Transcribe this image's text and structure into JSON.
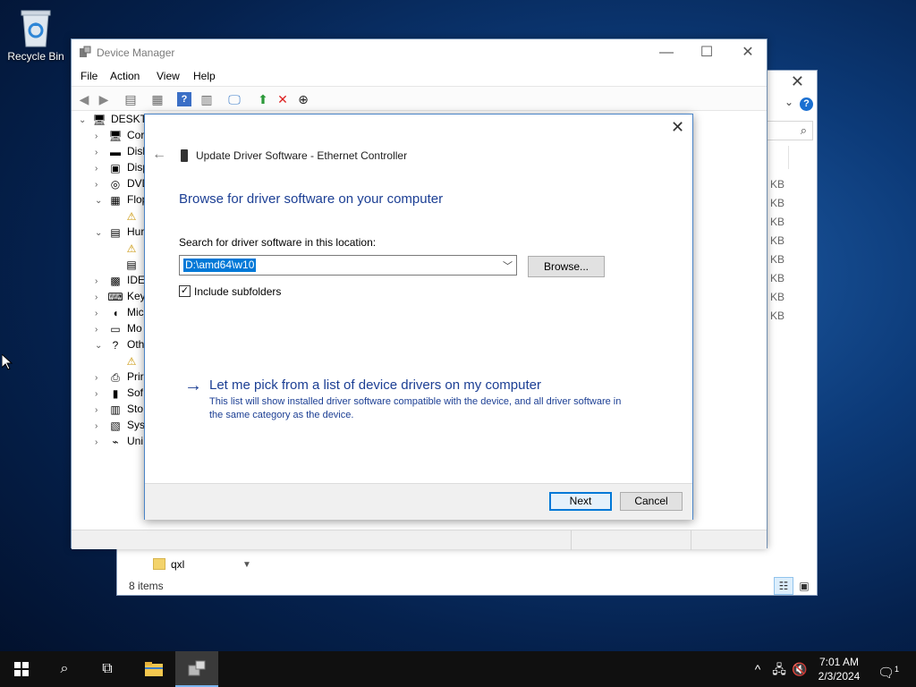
{
  "desktop": {
    "recycle_bin_label": "Recycle Bin"
  },
  "explorer": {
    "close_glyph": "✕",
    "size_unit": "KB",
    "visible_item": "qxl",
    "status": "8 items"
  },
  "device_manager": {
    "title": "Device Manager",
    "menu": [
      "File",
      "Action",
      "View",
      "Help"
    ],
    "tree": [
      {
        "label": "DESKTO",
        "icon": "computer-icon",
        "expander": "expanded",
        "indent": 0
      },
      {
        "label": "Cor",
        "icon": "computer-icon",
        "expander": "collapsed",
        "indent": 1
      },
      {
        "label": "Disl",
        "icon": "disk-drive-icon",
        "expander": "collapsed",
        "indent": 1
      },
      {
        "label": "Disp",
        "icon": "display-adapter-icon",
        "expander": "collapsed",
        "indent": 1
      },
      {
        "label": "DVD",
        "icon": "dvd-drive-icon",
        "expander": "collapsed",
        "indent": 1
      },
      {
        "label": "Flop",
        "icon": "floppy-controller-icon",
        "expander": "expanded",
        "indent": 1
      },
      {
        "label": "",
        "icon": "warning-device-icon",
        "expander": "none",
        "indent": 2
      },
      {
        "label": "Hur",
        "icon": "hid-device-icon",
        "expander": "expanded",
        "indent": 1
      },
      {
        "label": "",
        "icon": "warning-device-icon",
        "expander": "none",
        "indent": 2
      },
      {
        "label": "",
        "icon": "hid-device-icon",
        "expander": "none",
        "indent": 2
      },
      {
        "label": "IDE",
        "icon": "ide-controller-icon",
        "expander": "collapsed",
        "indent": 1
      },
      {
        "label": "Key",
        "icon": "keyboard-icon",
        "expander": "collapsed",
        "indent": 1
      },
      {
        "label": "Mic",
        "icon": "mouse-icon",
        "expander": "collapsed",
        "indent": 1
      },
      {
        "label": "Mo",
        "icon": "monitor-icon",
        "expander": "collapsed",
        "indent": 1
      },
      {
        "label": "Oth",
        "icon": "other-devices-icon",
        "expander": "expanded",
        "indent": 1
      },
      {
        "label": "",
        "icon": "warning-device-icon",
        "expander": "none",
        "indent": 2
      },
      {
        "label": "Prir",
        "icon": "printer-icon",
        "expander": "collapsed",
        "indent": 1
      },
      {
        "label": "Sof",
        "icon": "software-device-icon",
        "expander": "collapsed",
        "indent": 1
      },
      {
        "label": "Sto",
        "icon": "storage-controller-icon",
        "expander": "collapsed",
        "indent": 1
      },
      {
        "label": "Syst",
        "icon": "system-device-icon",
        "expander": "collapsed",
        "indent": 1
      },
      {
        "label": "Uni",
        "icon": "usb-controller-icon",
        "expander": "collapsed",
        "indent": 1
      }
    ]
  },
  "dialog": {
    "close_glyph": "✕",
    "back_glyph": "←",
    "title": "Update Driver Software - Ethernet Controller",
    "heading": "Browse for driver software on your computer",
    "search_label": "Search for driver software in this location:",
    "path_value": "D:\\amd64\\w10",
    "browse_label": "Browse...",
    "include_subfolders_label": "Include subfolders",
    "include_subfolders_checked": true,
    "pick_link_title": "Let me pick from a list of device drivers on my computer",
    "pick_link_description": "This list will show installed driver software compatible with the device, and all driver software in the same category as the device.",
    "next_label": "Next",
    "cancel_label": "Cancel"
  },
  "taskbar": {
    "time": "7:01 AM",
    "date": "2/3/2024",
    "notification_count": "1"
  }
}
